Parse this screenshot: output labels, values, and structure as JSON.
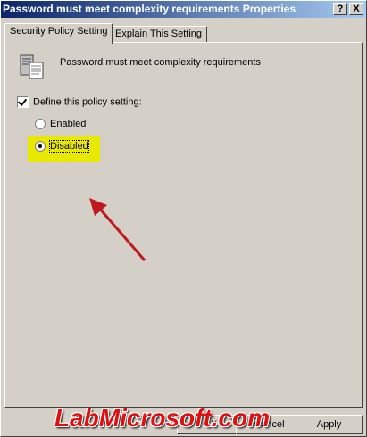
{
  "window": {
    "title": "Password must meet complexity requirements Properties",
    "help_button": "?",
    "close_button": "X"
  },
  "tabs": [
    {
      "label": "Security Policy Setting",
      "active": true
    },
    {
      "label": "Explain This Setting",
      "active": false
    }
  ],
  "policy": {
    "icon": "policy-server-icon",
    "name": "Password must meet complexity requirements"
  },
  "define_setting": {
    "label": "Define this policy setting:",
    "checked": true
  },
  "options": [
    {
      "label": "Enabled",
      "selected": false
    },
    {
      "label": "Disabled",
      "selected": true
    }
  ],
  "annotation": {
    "highlight_color": "#e8e800",
    "arrow_color": "#c0181e"
  },
  "buttons": {
    "ok": "OK",
    "cancel": "Cancel",
    "apply": "Apply"
  },
  "watermark": "LabMicrosoft.com"
}
